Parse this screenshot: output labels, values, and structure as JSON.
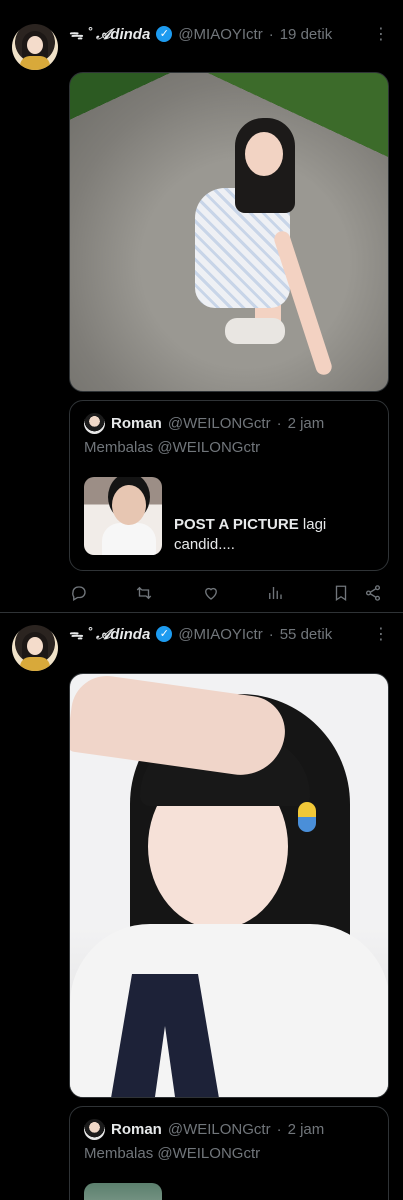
{
  "tweets": [
    {
      "author": {
        "name": "ᯓ ˚ 𝒜dinda",
        "handle": "@MIAOYIctr",
        "verified": true
      },
      "time": "19 detik",
      "more_label": "⋮",
      "quote": {
        "author_name": "Roman",
        "author_handle": "@WEILONGctr",
        "time": "2 jam",
        "reply_prefix": "Membalas",
        "reply_to": "@WEILONGctr",
        "text_bold": "POST A PICTURE",
        "text_rest": " lagi candid...."
      },
      "actions": [
        "reply-icon",
        "retweet-icon",
        "like-icon",
        "views-icon",
        "bookmark-icon",
        "share-icon"
      ]
    },
    {
      "author": {
        "name": "ᯓ ˚ 𝒜dinda",
        "handle": "@MIAOYIctr",
        "verified": true
      },
      "time": "55 detik",
      "more_label": "⋮",
      "quote": {
        "author_name": "Roman",
        "author_handle": "@WEILONGctr",
        "time": "2 jam",
        "reply_prefix": "Membalas",
        "reply_to": "@WEILONGctr"
      }
    }
  ],
  "separator": "·",
  "colors": {
    "background": "#000000",
    "text": "#e7e9ea",
    "muted": "#71767b",
    "border": "#2f3336",
    "verified": "#1d9bf0"
  }
}
